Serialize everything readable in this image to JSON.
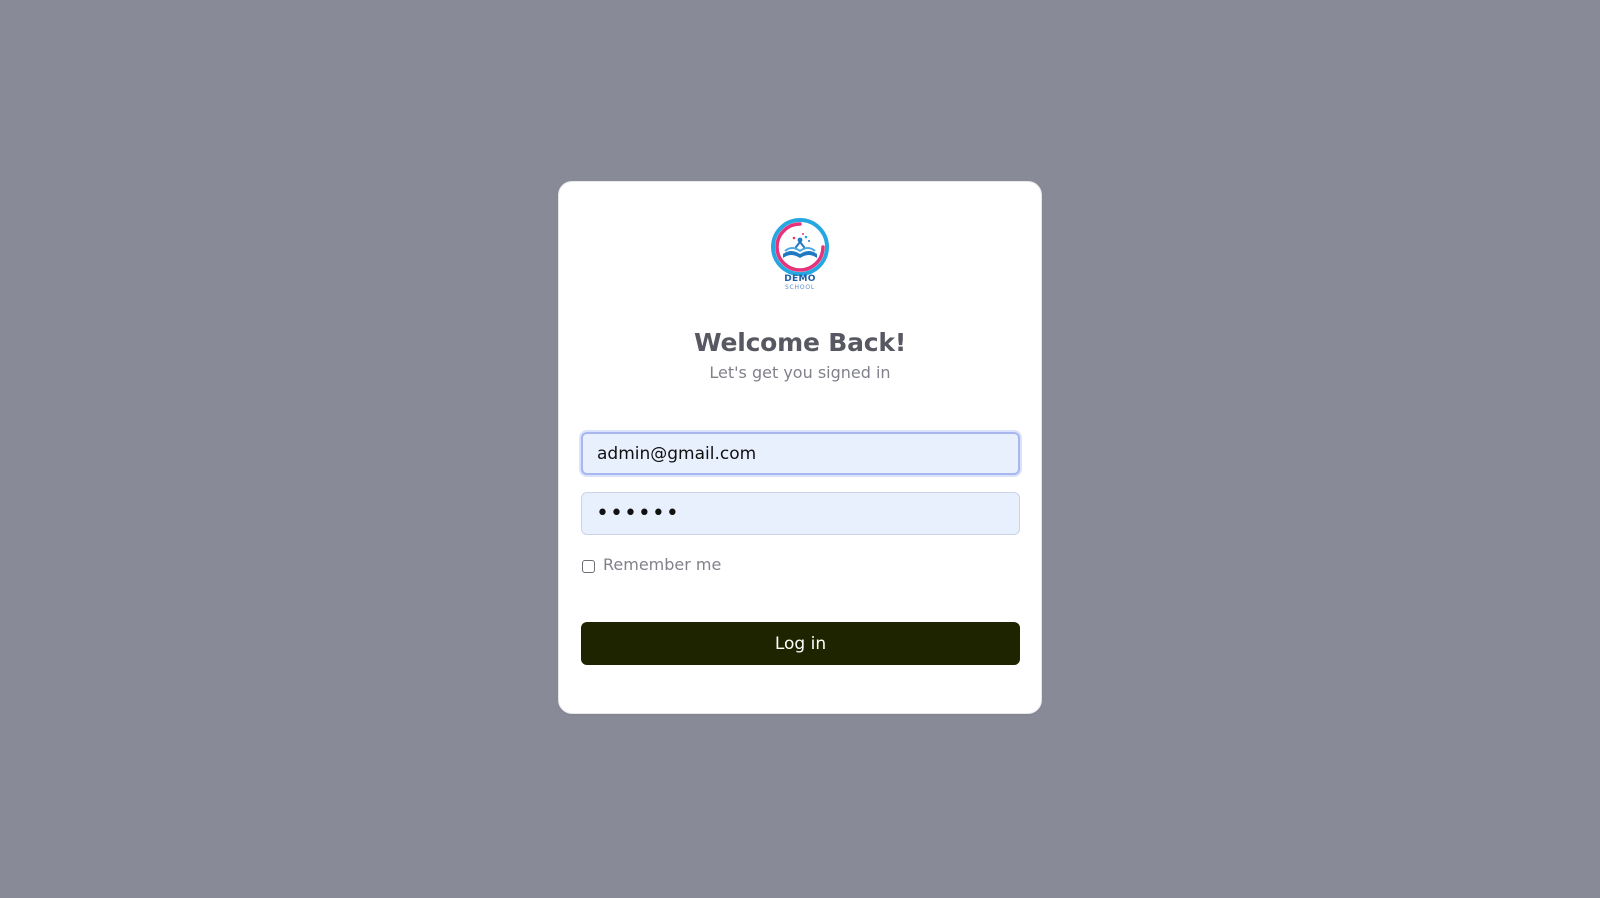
{
  "colors": {
    "background": "#888a97",
    "card": "#ffffff",
    "button": "#1f2400",
    "input_fill": "#e8f0fe",
    "logo_ring_blue": "#27a7e0",
    "logo_ring_pink": "#e5327b"
  },
  "logo": {
    "icon": "open-book-school-logo",
    "line1": "DEMO",
    "line2": "SCHOOL"
  },
  "heading": {
    "title": "Welcome Back!",
    "subtitle": "Let's get you signed in"
  },
  "form": {
    "email_value": "admin@gmail.com",
    "password_value": "••••••",
    "remember_label": "Remember me",
    "remember_checked": false,
    "submit_label": "Log in"
  }
}
